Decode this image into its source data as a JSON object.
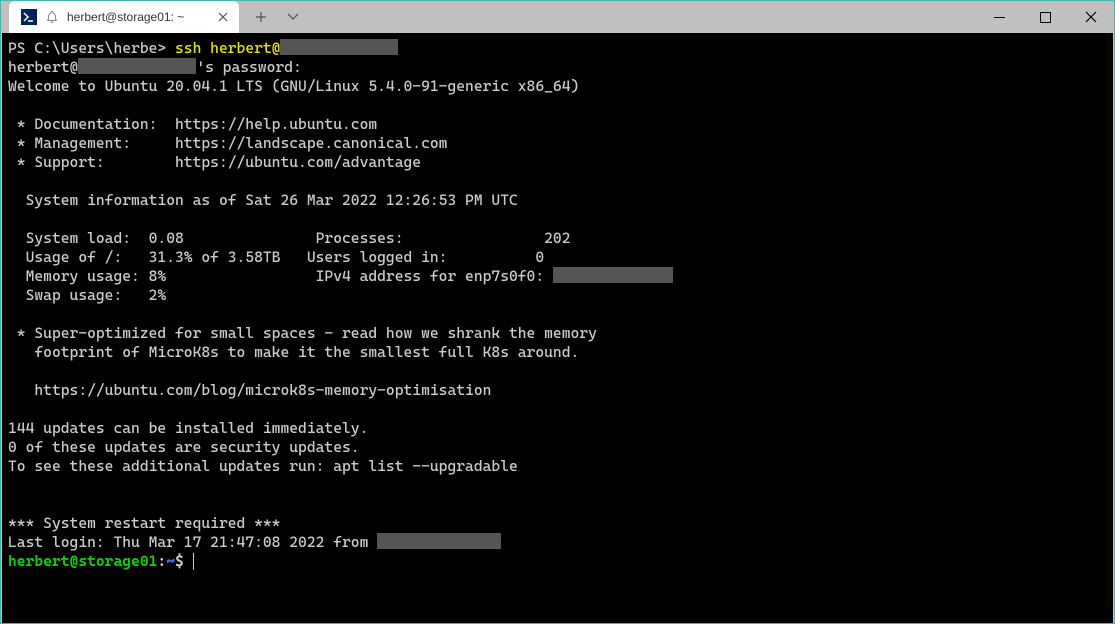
{
  "tab": {
    "title": "herbert@storage01: ~"
  },
  "terminal": {
    "line01_prefix": "PS C:\\Users\\herbe> ",
    "line01_cmd": "ssh herbert@",
    "line02_a": "herbert@",
    "line02_b": "'s password:",
    "line03": "Welcome to Ubuntu 20.04.1 LTS (GNU/Linux 5.4.0-91-generic x86_64)",
    "line05": " * Documentation:  https://help.ubuntu.com",
    "line06": " * Management:     https://landscape.canonical.com",
    "line07": " * Support:        https://ubuntu.com/advantage",
    "line09": "  System information as of Sat 26 Mar 2022 12:26:53 PM UTC",
    "line11": "  System load:  0.08               Processes:                202",
    "line12": "  Usage of /:   31.3% of 3.58TB   Users logged in:          0",
    "line13a": "  Memory usage: 8%                 IPv4 address for enp7s0f0: ",
    "line14": "  Swap usage:   2%",
    "line16": " * Super-optimized for small spaces - read how we shrank the memory",
    "line17": "   footprint of MicroK8s to make it the smallest full K8s around.",
    "line19": "   https://ubuntu.com/blog/microk8s-memory-optimisation",
    "line21": "144 updates can be installed immediately.",
    "line22": "0 of these updates are security updates.",
    "line23": "To see these additional updates run: apt list --upgradable",
    "line26": "*** System restart required ***",
    "line27a": "Last login: Thu Mar 17 21:47:08 2022 from ",
    "prompt_user": "herbert@storage01",
    "prompt_colon": ":",
    "prompt_path": "~",
    "prompt_dollar": "$ "
  }
}
